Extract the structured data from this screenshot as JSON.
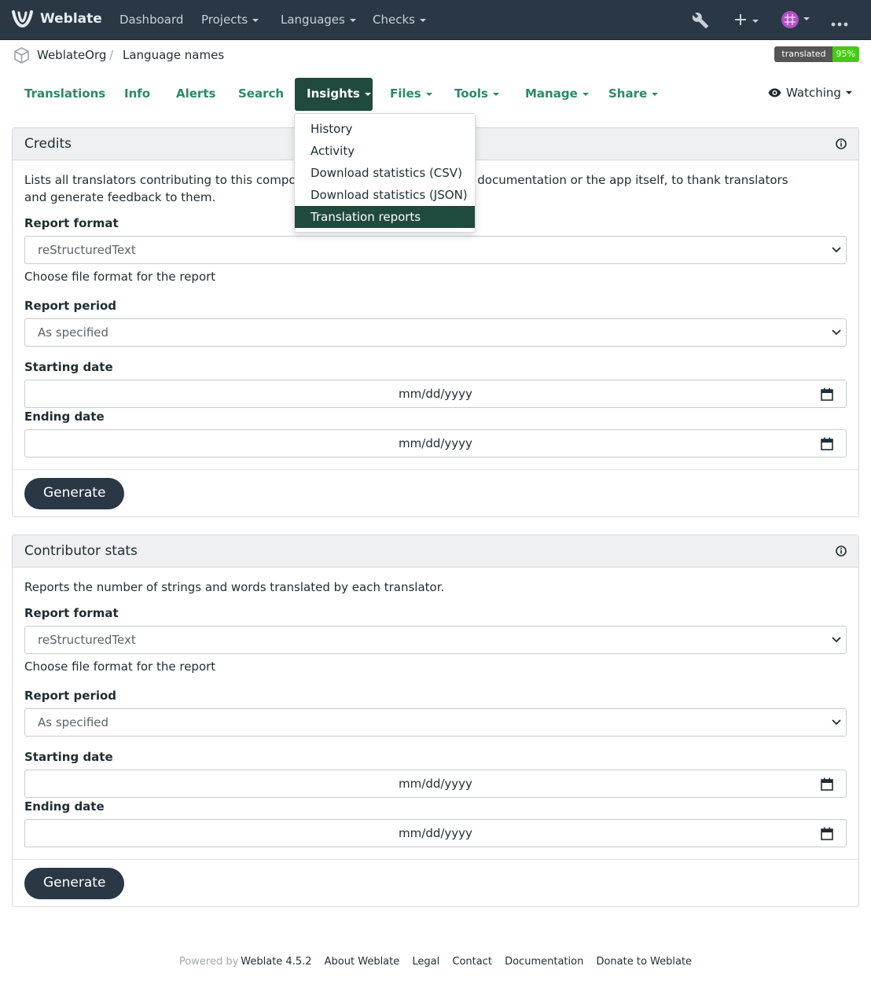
{
  "navbar": {
    "brand": "Weblate",
    "items": [
      "Dashboard",
      "Projects",
      "Languages",
      "Checks"
    ]
  },
  "breadcrumb": {
    "project": "WeblateOrg",
    "separator": "/",
    "component": "Language names"
  },
  "badge": {
    "label": "translated",
    "value": "95%"
  },
  "tabs": {
    "items": [
      "Translations",
      "Info",
      "Alerts",
      "Search",
      "Insights",
      "Files",
      "Tools",
      "Manage",
      "Share"
    ],
    "watching": "Watching"
  },
  "insights_menu": [
    "History",
    "Activity",
    "Download statistics (CSV)",
    "Download statistics (JSON)",
    "Translation reports"
  ],
  "credits": {
    "title": "Credits",
    "description_line1": "Lists all translators contributing to this component or project for inclusion in documentation or the app itself, to thank translators",
    "description_line2": "and generate feedback to them.",
    "report_format_label": "Report format",
    "report_format_value": "reStructuredText",
    "report_format_help": "Choose file format for the report",
    "report_period_label": "Report period",
    "report_period_value": "As specified",
    "starting_date_label": "Starting date",
    "ending_date_label": "Ending date",
    "date_placeholder": "mm/dd/yyyy",
    "generate": "Generate"
  },
  "contributor_stats": {
    "title": "Contributor stats",
    "description": "Reports the number of strings and words translated by each translator.",
    "report_format_label": "Report format",
    "report_format_value": "reStructuredText",
    "report_format_help": "Choose file format for the report",
    "report_period_label": "Report period",
    "report_period_value": "As specified",
    "starting_date_label": "Starting date",
    "ending_date_label": "Ending date",
    "date_placeholder": "mm/dd/yyyy",
    "generate": "Generate"
  },
  "footer": {
    "powered_by": "Powered by",
    "version": "Weblate 4.5.2",
    "links": [
      "About Weblate",
      "Legal",
      "Contact",
      "Documentation",
      "Donate to Weblate"
    ]
  },
  "icons": {
    "logo": "weblate-logo-icon",
    "wrench": "wrench-icon",
    "plus": "plus-icon",
    "avatar": "avatar-icon",
    "more": "more-icon",
    "eye": "eye-icon",
    "info": "info-icon",
    "calendar": "calendar-icon"
  }
}
